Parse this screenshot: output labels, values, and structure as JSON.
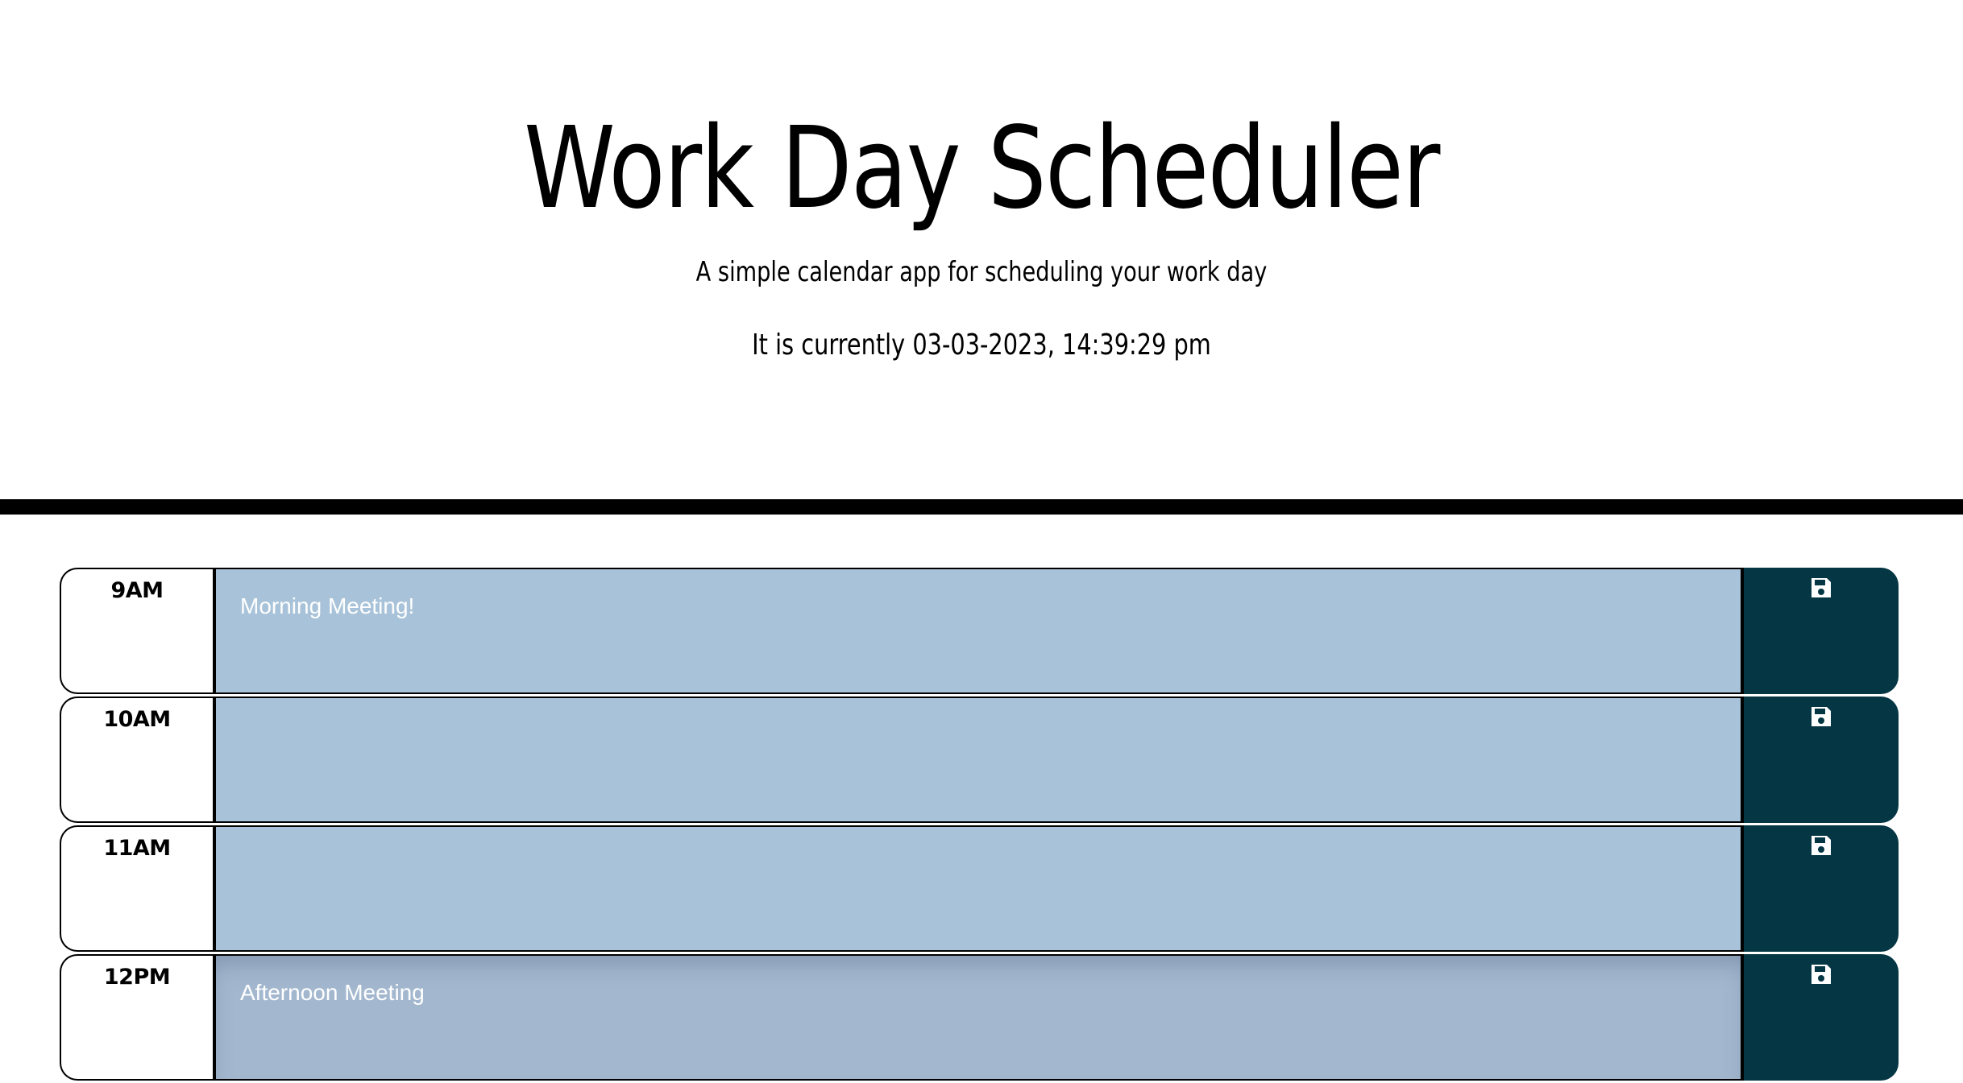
{
  "header": {
    "title": "Work Day Scheduler",
    "subtitle": "A simple calendar app for scheduling your work day",
    "current_time": "It is currently 03-03-2023, 14:39:29 pm"
  },
  "colors": {
    "description_bg": "#a8c3d9",
    "save_button_bg": "#053643",
    "divider": "#000000"
  },
  "time_blocks": [
    {
      "hour": "9AM",
      "text": "Morning Meeting!",
      "save_icon": "floppy-disk-icon"
    },
    {
      "hour": "10AM",
      "text": "",
      "save_icon": "floppy-disk-icon"
    },
    {
      "hour": "11AM",
      "text": "",
      "save_icon": "floppy-disk-icon"
    },
    {
      "hour": "12PM",
      "text": "Afternoon Meeting",
      "save_icon": "floppy-disk-icon"
    }
  ]
}
